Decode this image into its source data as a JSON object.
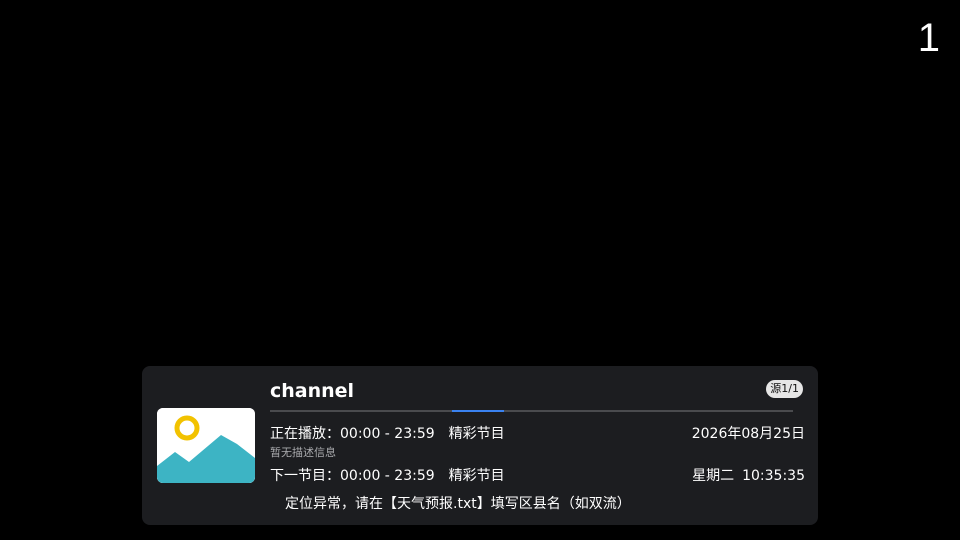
{
  "overlay": {
    "channel_number": "1"
  },
  "info_panel": {
    "logo_icon": "image-placeholder-icon",
    "channel_name": "channel",
    "source_badge": "源1/1",
    "progress_fraction": 0.1,
    "now_playing": {
      "label": "正在播放：",
      "time": "00:00 - 23:59",
      "title": "精彩节目",
      "description": "暂无描述信息"
    },
    "next_program": {
      "label": "下一节目：",
      "time": "00:00 - 23:59",
      "title": "精彩节目"
    },
    "date": "2026年08月25日",
    "weekday": "星期二",
    "clock": "10:35:35",
    "weather_notice": "定位异常，请在【天气预报.txt】填写区县名（如双流）"
  },
  "colors": {
    "background": "#000000",
    "panel": "#1c1d20",
    "progress_accent": "#3a82f0",
    "logo_sun": "#f2c200",
    "logo_mountain": "#3db4c4"
  }
}
